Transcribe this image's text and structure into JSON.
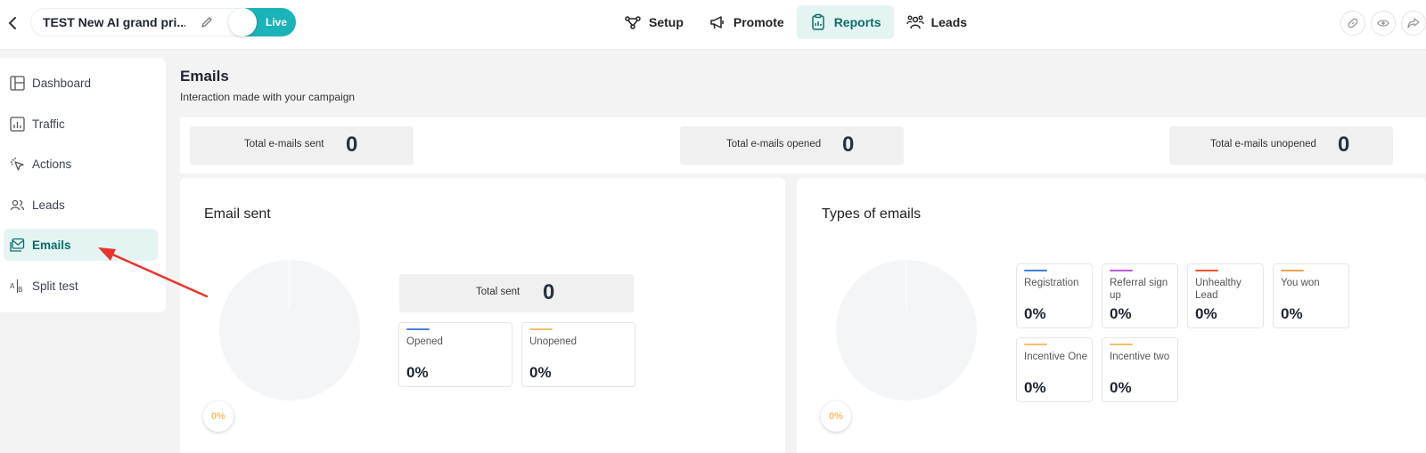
{
  "header": {
    "campaign_title": "TEST New AI grand pri...",
    "status_label": "Live",
    "nav": [
      {
        "label": "Setup",
        "icon": "setup-icon"
      },
      {
        "label": "Promote",
        "icon": "megaphone-icon"
      },
      {
        "label": "Reports",
        "icon": "clipboard-icon"
      },
      {
        "label": "Leads",
        "icon": "people-icon"
      }
    ],
    "active_nav": "Reports",
    "actions": [
      "link-icon",
      "eye-icon",
      "share-icon"
    ]
  },
  "sidebar": {
    "items": [
      {
        "label": "Dashboard",
        "icon": "dashboard-icon"
      },
      {
        "label": "Traffic",
        "icon": "chart-icon"
      },
      {
        "label": "Actions",
        "icon": "cursor-click-icon"
      },
      {
        "label": "Leads",
        "icon": "users-icon"
      },
      {
        "label": "Emails",
        "icon": "mail-icon"
      },
      {
        "label": "Split test",
        "icon": "ab-icon"
      }
    ],
    "active": "Emails"
  },
  "page": {
    "title": "Emails",
    "subtitle": "Interaction made with your campaign"
  },
  "stats": [
    {
      "label": "Total e-mails sent",
      "value": "0"
    },
    {
      "label": "Total e-mails opened",
      "value": "0"
    },
    {
      "label": "Total e-mails unopened",
      "value": "0"
    }
  ],
  "email_sent": {
    "title": "Email sent",
    "pie_label": "0%",
    "total_label": "Total sent",
    "total_value": "0",
    "cards": [
      {
        "label": "Opened",
        "value": "0%",
        "color": "#4a7fe0"
      },
      {
        "label": "Unopened",
        "value": "0%",
        "color": "#f5c06a"
      }
    ]
  },
  "types_of_emails": {
    "title": "Types of emails",
    "pie_label": "0%",
    "cards": [
      {
        "label": "Registration",
        "value": "0%",
        "color": "#3d7fd6"
      },
      {
        "label": "Referral sign up",
        "value": "0%",
        "color": "#b85ad6"
      },
      {
        "label": "Unhealthy Lead",
        "value": "0%",
        "color": "#e8552f"
      },
      {
        "label": "You won",
        "value": "0%",
        "color": "#f0a04a"
      },
      {
        "label": "Incentive One",
        "value": "0%",
        "color": "#f5c06a"
      },
      {
        "label": "Incentive two",
        "value": "0%",
        "color": "#f5c06a"
      }
    ]
  },
  "colors": {
    "accent": "#1ab3b8",
    "active_bg": "#e3f4f3",
    "active_text": "#0e6e69",
    "annotation_arrow": "#e8352a"
  }
}
